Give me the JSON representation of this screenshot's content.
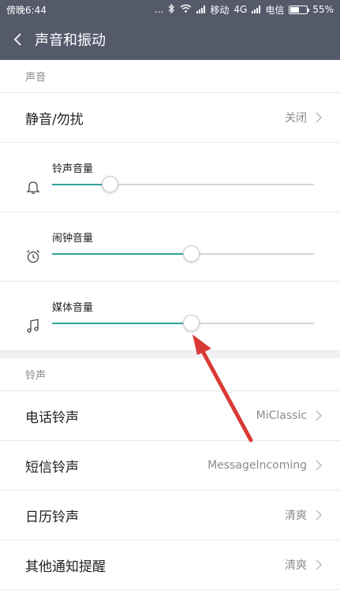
{
  "status_bar": {
    "time": "傍晚6:44",
    "dots": "...",
    "carrier1": "移动",
    "network": "4G",
    "carrier2": "电信",
    "battery": "55%",
    "battery_level": 0.55
  },
  "header": {
    "title": "声音和振动"
  },
  "sound_section": {
    "header": "声音",
    "mute": {
      "label": "静音/勿扰",
      "value": "关闭"
    },
    "sliders": [
      {
        "label": "铃声音量",
        "icon": "bell-icon",
        "level": 0.22
      },
      {
        "label": "闹钟音量",
        "icon": "alarm-clock-icon",
        "level": 0.53
      },
      {
        "label": "媒体音量",
        "icon": "music-note-icon",
        "level": 0.53
      }
    ]
  },
  "ringtone_section": {
    "header": "铃声",
    "items": [
      {
        "label": "电话铃声",
        "value": "MiClassic"
      },
      {
        "label": "短信铃声",
        "value": "MessageIncoming"
      },
      {
        "label": "日历铃声",
        "value": "清爽"
      },
      {
        "label": "其他通知提醒",
        "value": "清爽"
      }
    ]
  },
  "colors": {
    "header_bg": "#555a6b",
    "accent": "#2fa39a",
    "annotation_arrow": "#d93a35"
  }
}
